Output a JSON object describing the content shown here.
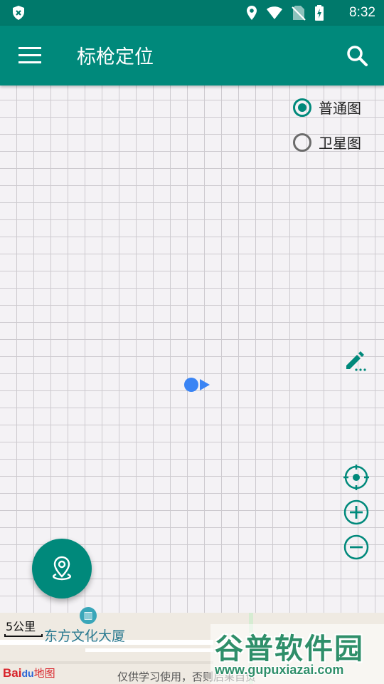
{
  "status_bar": {
    "time": "8:32"
  },
  "app_bar": {
    "title": "标枪定位"
  },
  "map_type": {
    "options": [
      {
        "label": "普通图",
        "selected": true
      },
      {
        "label": "卫星图",
        "selected": false
      }
    ]
  },
  "map": {
    "scale_label": "5公里",
    "poi_label": "东方文化大厦",
    "logo_text": "Bai",
    "logo_suffix": "du",
    "logo_map": "地图",
    "copyright": "仅供学习使用，否则后果自负"
  },
  "watermark": {
    "title": "谷普软件园",
    "url": "www.gupuxiazai.com"
  },
  "colors": {
    "primary": "#00897b",
    "primary_dark": "#00796b",
    "location_blue": "#3a84f4"
  }
}
